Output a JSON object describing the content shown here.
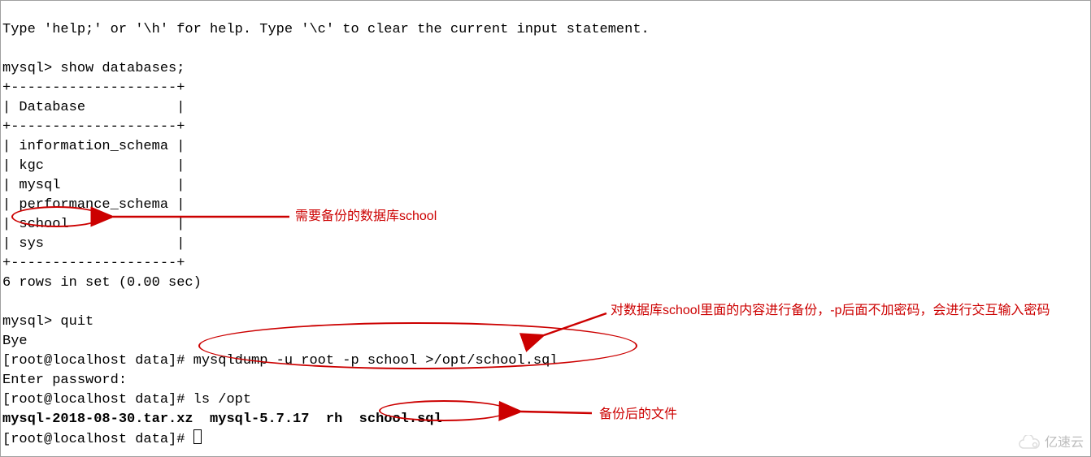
{
  "terminal": {
    "line01": "Type 'help;' or '\\h' for help. Type '\\c' to clear the current input statement.",
    "line02": "",
    "line03": "mysql> show databases;",
    "line04": "+--------------------+",
    "line05": "| Database           |",
    "line06": "+--------------------+",
    "line07": "| information_schema |",
    "line08": "| kgc                |",
    "line09": "| mysql              |",
    "line10": "| performance_schema |",
    "line11": "| school             |",
    "line12": "| sys                |",
    "line13": "+--------------------+",
    "line14": "6 rows in set (0.00 sec)",
    "line15": "",
    "line16": "mysql> quit",
    "line17": "Bye",
    "line18": "[root@localhost data]# mysqldump -u root -p school >/opt/school.sql",
    "line19": "Enter password:",
    "line20": "[root@localhost data]# ls /opt",
    "line21_bold": "mysql-2018-08-30.tar.xz  mysql-5.7.17  rh  school.sql",
    "line22": "[root@localhost data]# "
  },
  "annotations": {
    "a1": "需要备份的数据库school",
    "a2": "对数据库school里面的内容进行备份，-p后面不加密码，会进行交互输入密码",
    "a3": "备份后的文件"
  },
  "watermark": "亿速云"
}
